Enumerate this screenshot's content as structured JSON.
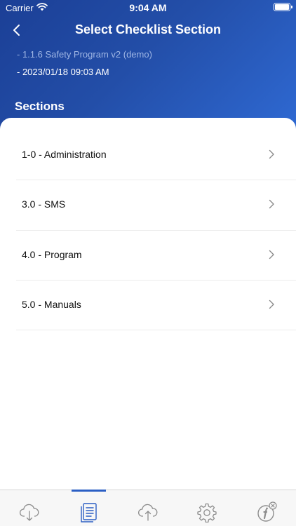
{
  "status_bar": {
    "carrier": "Carrier",
    "time": "9:04 AM"
  },
  "nav": {
    "title": "Select Checklist Section",
    "back_icon": "chevron-left-icon"
  },
  "subtitle": {
    "program": "- 1.1.6 Safety Program v2 (demo)",
    "datetime": "- 2023/01/18  09:03 AM"
  },
  "sections_heading": "Sections",
  "sections": [
    {
      "label": "1-0 - Administration"
    },
    {
      "label": "3.0 - SMS"
    },
    {
      "label": "4.0 - Program"
    },
    {
      "label": "5.0 - Manuals"
    }
  ],
  "tabs": [
    {
      "icon": "cloud-download-icon"
    },
    {
      "icon": "checklist-icon",
      "active": true
    },
    {
      "icon": "cloud-upload-icon"
    },
    {
      "icon": "settings-gear-icon"
    },
    {
      "icon": "info-icon"
    }
  ],
  "colors": {
    "accent": "#2b5fc4",
    "header_start": "#1b3f96",
    "header_end": "#2f6ad4",
    "tab_icon": "#8d8d8d"
  }
}
